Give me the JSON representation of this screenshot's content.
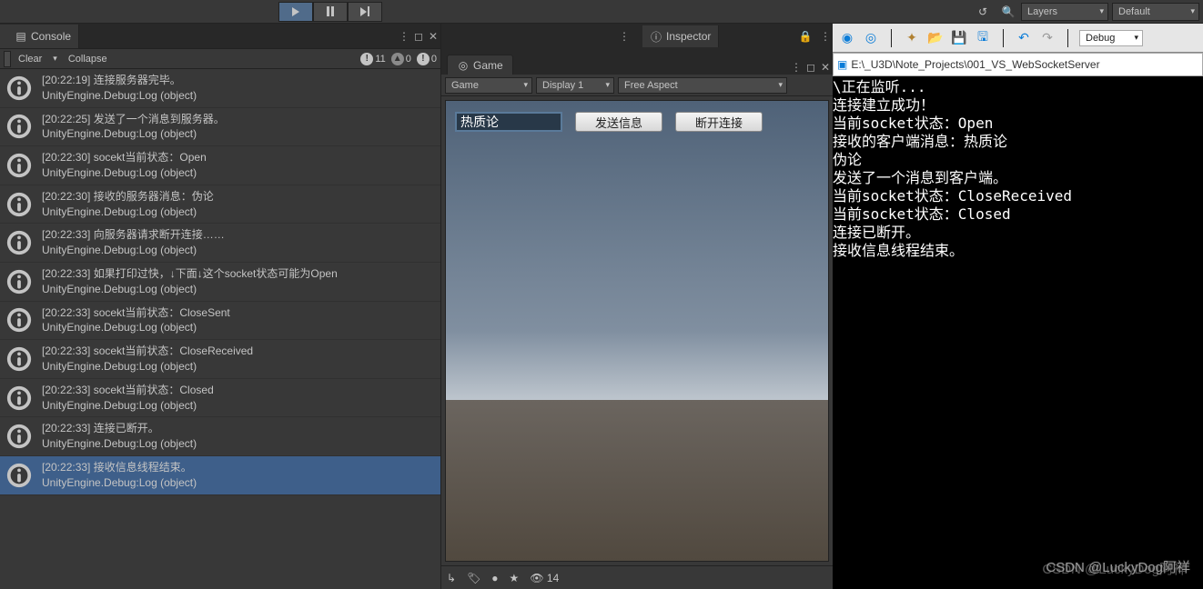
{
  "toolbar": {
    "layers_label": "Layers",
    "layout_label": "Default",
    "debug_label": "Debug"
  },
  "console": {
    "tab_label": "Console",
    "clear_label": "Clear",
    "collapse_label": "Collapse",
    "info_count": "11",
    "warn_count": "0",
    "err_count": "0",
    "logs": [
      {
        "line1": "[20:22:19] 连接服务器完毕。",
        "line2": "UnityEngine.Debug:Log (object)"
      },
      {
        "line1": "[20:22:25] 发送了一个消息到服务器。",
        "line2": "UnityEngine.Debug:Log (object)"
      },
      {
        "line1": "[20:22:30] socekt当前状态：Open",
        "line2": "UnityEngine.Debug:Log (object)"
      },
      {
        "line1": "[20:22:30] 接收的服务器消息：伪论",
        "line2": "UnityEngine.Debug:Log (object)"
      },
      {
        "line1": "[20:22:33] 向服务器请求断开连接……",
        "line2": "UnityEngine.Debug:Log (object)"
      },
      {
        "line1": "[20:22:33] 如果打印过快，↓下面↓这个socket状态可能为Open",
        "line2": "UnityEngine.Debug:Log (object)"
      },
      {
        "line1": "[20:22:33] socekt当前状态：CloseSent",
        "line2": "UnityEngine.Debug:Log (object)"
      },
      {
        "line1": "[20:22:33] socekt当前状态：CloseReceived",
        "line2": "UnityEngine.Debug:Log (object)"
      },
      {
        "line1": "[20:22:33] socekt当前状态：Closed",
        "line2": "UnityEngine.Debug:Log (object)"
      },
      {
        "line1": "[20:22:33] 连接已断开。",
        "line2": "UnityEngine.Debug:Log (object)"
      },
      {
        "line1": "[20:22:33] 接收信息线程结束。",
        "line2": "UnityEngine.Debug:Log (object)"
      }
    ]
  },
  "inspector": {
    "tab_label": "Inspector"
  },
  "game": {
    "tab_label": "Game",
    "mode_dd": "Game",
    "display_dd": "Display 1",
    "aspect_dd": "Free Aspect",
    "input_value": "热质论",
    "send_label": "发送信息",
    "disconnect_label": "断开连接",
    "hidden_count": "14"
  },
  "vs": {
    "path": "E:\\_U3D\\Note_Projects\\001_VS_WebSocketServer",
    "lines": [
      "\\正在监听...",
      "连接建立成功！",
      "当前socket状态：Open",
      "接收的客户端消息：热质论",
      "伪论",
      "发送了一个消息到客户端。",
      "当前socket状态：CloseReceived",
      "当前socket状态：Closed",
      "连接已断开。",
      "接收信息线程结束。"
    ]
  },
  "watermark": "CSDN @LuckyDog阿祥"
}
